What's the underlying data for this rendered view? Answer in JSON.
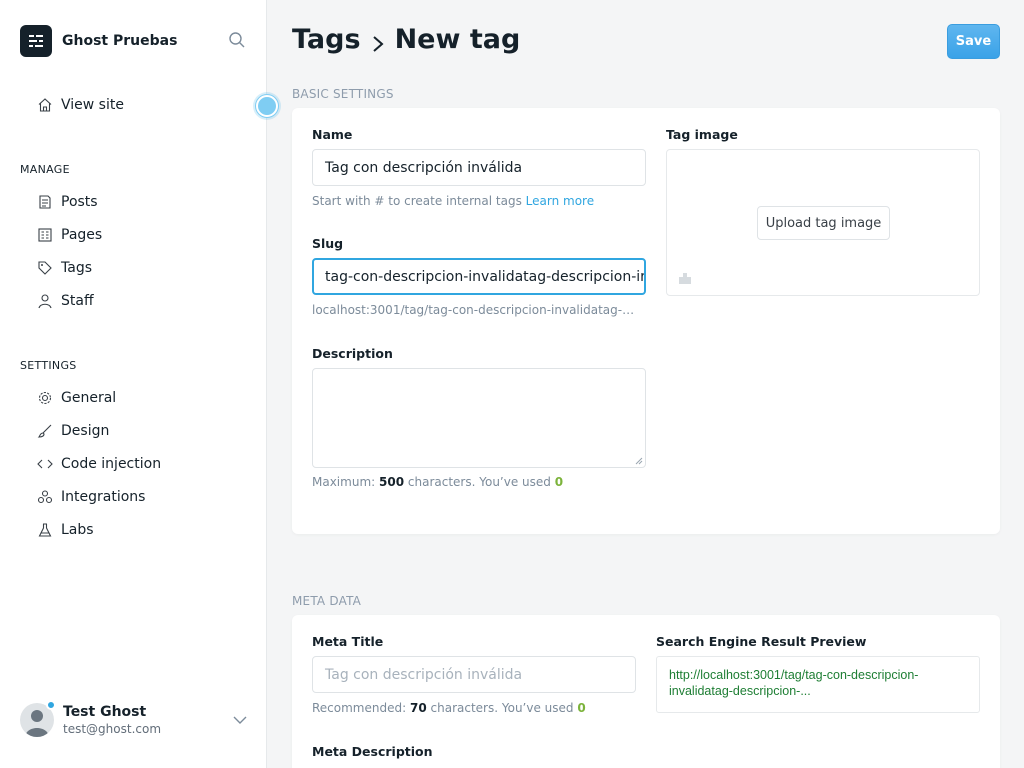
{
  "sidebar": {
    "brand": "Ghost Pruebas",
    "view_site": "View site",
    "manage_title": "MANAGE",
    "manage_items": [
      {
        "label": "Posts",
        "icon": "posts-icon"
      },
      {
        "label": "Pages",
        "icon": "pages-icon"
      },
      {
        "label": "Tags",
        "icon": "tag-icon"
      },
      {
        "label": "Staff",
        "icon": "staff-icon"
      }
    ],
    "settings_title": "SETTINGS",
    "settings_items": [
      {
        "label": "General",
        "icon": "gear-icon"
      },
      {
        "label": "Design",
        "icon": "brush-icon"
      },
      {
        "label": "Code injection",
        "icon": "code-icon"
      },
      {
        "label": "Integrations",
        "icon": "integrations-icon"
      },
      {
        "label": "Labs",
        "icon": "flask-icon"
      }
    ],
    "user": {
      "name": "Test Ghost",
      "email": "test@ghost.com"
    }
  },
  "header": {
    "crumb_parent": "Tags",
    "crumb_current": "New tag",
    "save_label": "Save"
  },
  "basic": {
    "section_title": "BASIC SETTINGS",
    "name_label": "Name",
    "name_value": "Tag con descripción inválida",
    "name_hint": "Start with # to create internal tags",
    "name_hint_link": "Learn more",
    "slug_label": "Slug",
    "slug_value": "tag-con-descripcion-invalidatag-descripcion-ir",
    "slug_url": "localhost:3001/tag/tag-con-descripcion-invalidatag-d...",
    "description_label": "Description",
    "description_hint_prefix": "Maximum:",
    "description_max": "500",
    "description_hint_mid": "characters. You’ve used",
    "description_used": "0",
    "image_label": "Tag image",
    "upload_label": "Upload tag image"
  },
  "meta": {
    "section_title": "META DATA",
    "meta_title_label": "Meta Title",
    "meta_title_placeholder": "Tag con descripción inválida",
    "meta_title_hint_prefix": "Recommended:",
    "meta_title_recommended": "70",
    "meta_title_hint_mid": "characters. You’ve used",
    "meta_title_used": "0",
    "serp_label": "Search Engine Result Preview",
    "serp_url": "http://localhost:3001/tag/tag-con-descripcion-invalidatag-descripcion-...",
    "meta_description_label": "Meta Description"
  },
  "colors": {
    "accent": "#30a6e0",
    "save_button": "#5fb6ef",
    "count_green": "#7cb33b",
    "serp_green": "#1e7e34"
  }
}
